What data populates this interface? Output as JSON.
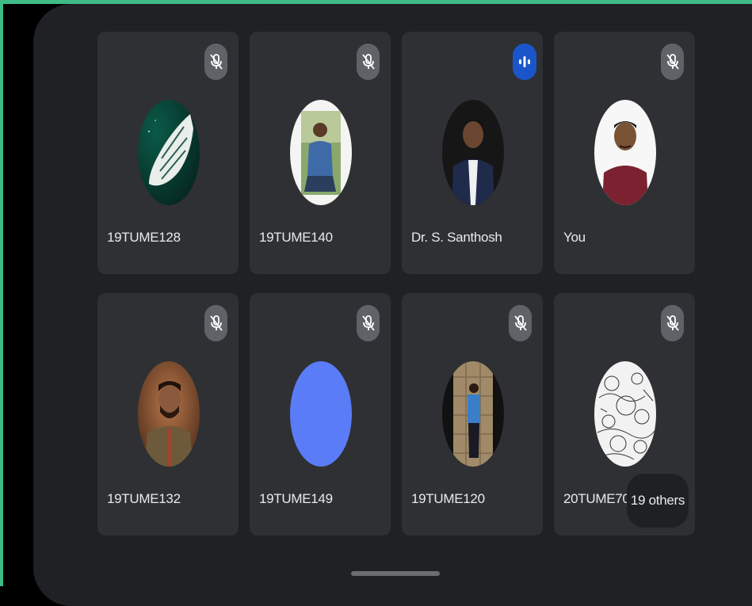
{
  "participants": [
    {
      "name": "19TUME128",
      "status": "muted",
      "avatar": "white-wing-logo"
    },
    {
      "name": "19TUME140",
      "status": "muted",
      "avatar": "photo-man-blue-shirt-sitting"
    },
    {
      "name": "Dr. S. Santhosh",
      "status": "speaking",
      "avatar": "photo-man-suit"
    },
    {
      "name": "You",
      "status": "muted",
      "avatar": "photo-man-maroon-shirt"
    },
    {
      "name": "19TUME132",
      "status": "muted",
      "avatar": "photo-man-beard-warm-light"
    },
    {
      "name": "19TUME149",
      "status": "muted",
      "avatar": "blue-circle-placeholder"
    },
    {
      "name": "19TUME120",
      "status": "muted",
      "avatar": "photo-man-standing-stone-wall"
    },
    {
      "name": "20TUME702",
      "status": "muted",
      "avatar": "doodle-art"
    }
  ],
  "overflow": {
    "label": "19 others"
  },
  "icons": {
    "muted": "mic-off-icon",
    "speaking": "audio-level-icon"
  },
  "colors": {
    "frame_green": "#3fbb86",
    "background": "#202124",
    "tile": "#2f3033",
    "mute_badge": "#5f6368",
    "speaking_badge": "#1a56c9",
    "placeholder_blue": "#5b7cf7",
    "text": "#e8eaed"
  }
}
